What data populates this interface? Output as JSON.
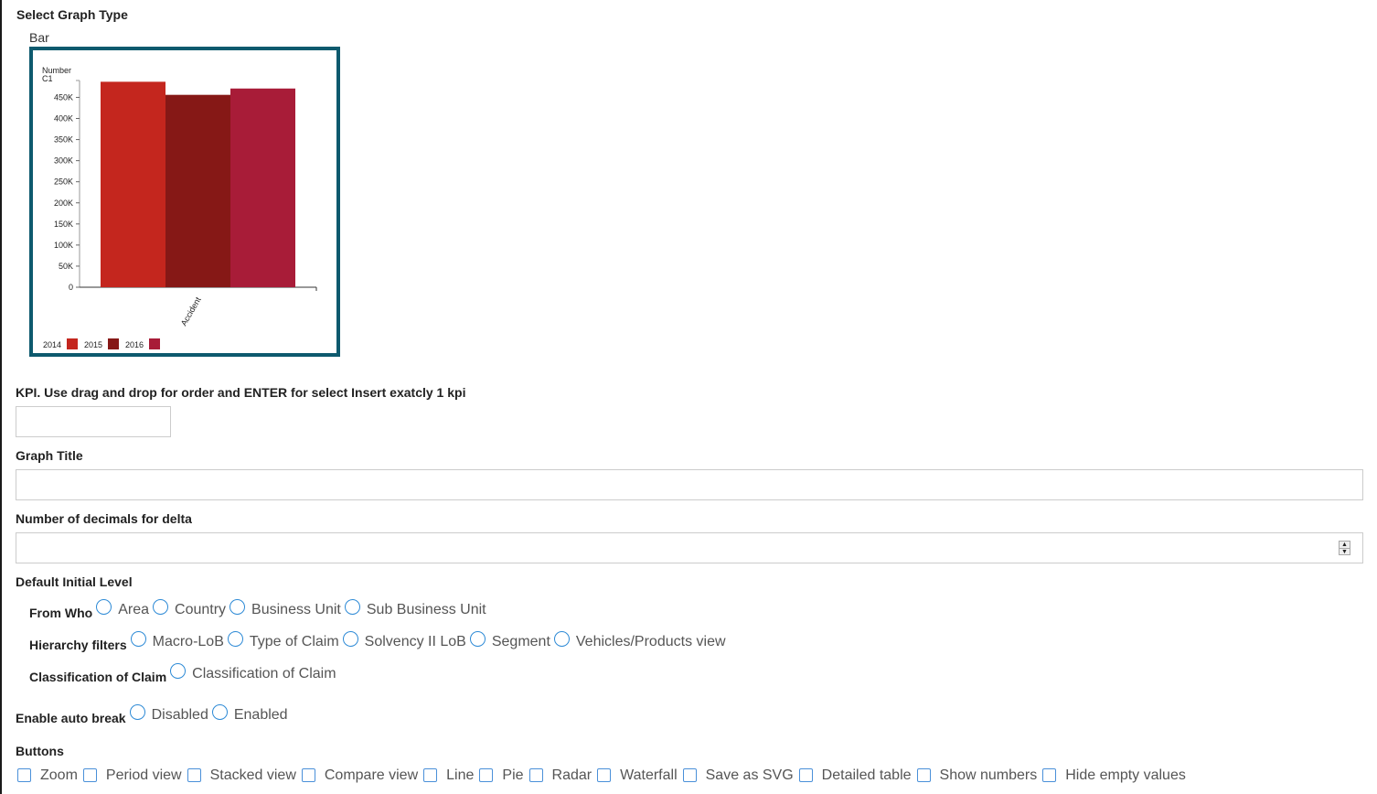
{
  "graph_type": {
    "section_label": "Select Graph Type",
    "selected_type": "Bar",
    "accent_border_color": "#0e5a6e"
  },
  "chart_data": {
    "type": "bar",
    "title": "",
    "ylabel": "Number C1",
    "ylabel_lines": [
      "Number",
      "C1"
    ],
    "xlabel": "",
    "categories": [
      "Accident"
    ],
    "series": [
      {
        "name": "2014",
        "values": [
          487000
        ],
        "color": "#c4261e"
      },
      {
        "name": "2015",
        "values": [
          456000
        ],
        "color": "#861816"
      },
      {
        "name": "2016",
        "values": [
          471000
        ],
        "color": "#a81c38"
      }
    ],
    "ylim": [
      0,
      490000
    ],
    "yticks": [
      0,
      50000,
      100000,
      150000,
      200000,
      250000,
      300000,
      350000,
      400000,
      450000
    ],
    "ytick_labels": [
      "0",
      "50K",
      "100K",
      "150K",
      "200K",
      "250K",
      "300K",
      "350K",
      "400K",
      "450K"
    ],
    "grid": false,
    "legend_position": "bottom-left"
  },
  "kpi": {
    "label": "KPI. Use drag and drop for order and ENTER for select Insert exatcly 1 kpi",
    "value": ""
  },
  "graph_title": {
    "label": "Graph Title",
    "value": ""
  },
  "decimals": {
    "label": "Number of decimals for delta",
    "value": ""
  },
  "default_level": {
    "label": "Default Initial Level",
    "groups": [
      {
        "label": "From Who",
        "options": [
          "Area",
          "Country",
          "Business Unit",
          "Sub Business Unit"
        ]
      },
      {
        "label": "Hierarchy filters",
        "options": [
          "Macro-LoB",
          "Type of Claim",
          "Solvency II LoB",
          "Segment",
          "Vehicles/Products view"
        ]
      },
      {
        "label": "Classification of Claim",
        "options": [
          "Classification of Claim"
        ]
      }
    ]
  },
  "auto_break": {
    "label": "Enable auto break",
    "options": [
      "Disabled",
      "Enabled"
    ]
  },
  "buttons": {
    "label": "Buttons",
    "options": [
      "Zoom",
      "Period view",
      "Stacked view",
      "Compare view",
      "Line",
      "Pie",
      "Radar",
      "Waterfall",
      "Save as SVG",
      "Detailed table",
      "Show numbers",
      "Hide empty values"
    ]
  }
}
